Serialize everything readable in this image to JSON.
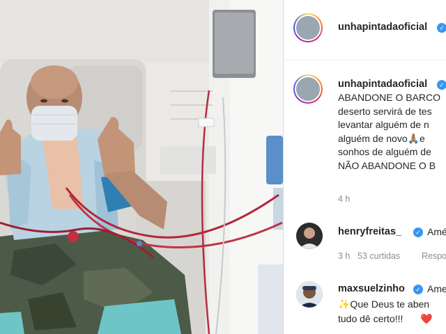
{
  "post": {
    "author": "unhapintadaoficial",
    "caption_lines": [
      "ABANDONE O BARCO",
      "deserto servirá de tes",
      "levantar alguém de n",
      "alguém de novo🙏🏽e",
      "sonhos de alguém de",
      "NÃO ABANDONE O B"
    ],
    "caption_author": "unhapintadaoficial",
    "time": "4 h"
  },
  "comments": [
    {
      "user": "henryfreitas_",
      "text": "Amé",
      "time": "3 h",
      "likes": "53 curtidas",
      "reply": "Respo"
    },
    {
      "user": "maxsuelzinho",
      "text": "Ame",
      "line2": "✨Que Deus te aben",
      "line3": "tudo dê certo!!!",
      "emoji": "❤️"
    }
  ],
  "colors": {
    "verified": "#3897f0",
    "heart": "#ed4956",
    "meta": "#8e8e8e"
  },
  "icons": [
    "verified-badge-icon",
    "heart-icon"
  ]
}
